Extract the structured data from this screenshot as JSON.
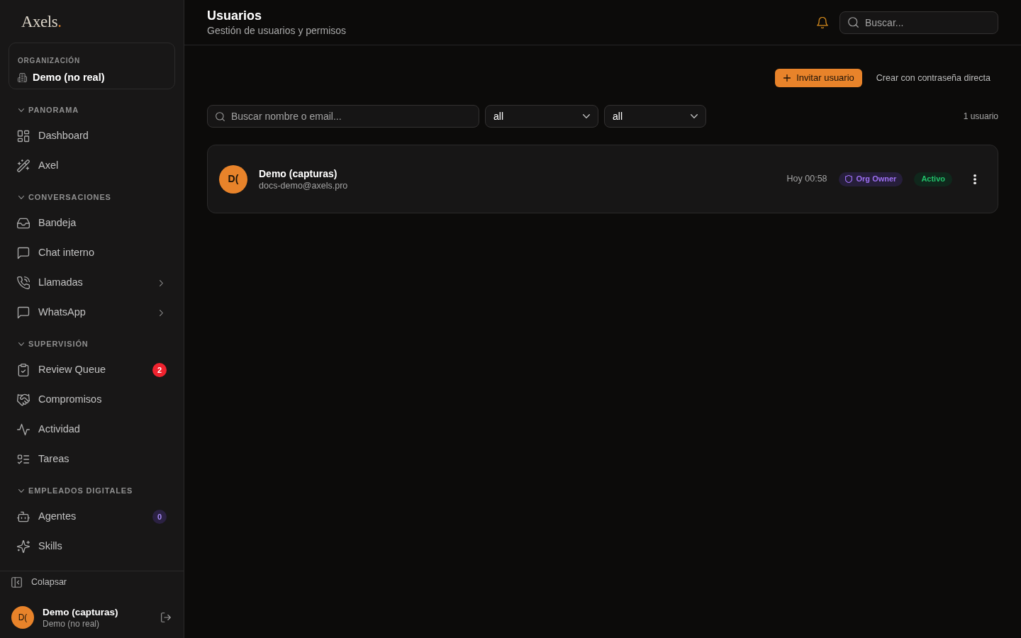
{
  "sidebar": {
    "logo": "Axels",
    "logo_mark": ".",
    "organization": {
      "label": "ORGANIZACIÓN",
      "name": "Demo (no real)"
    },
    "sections": [
      {
        "title": "PANORAMA",
        "expanded": true,
        "items": [
          {
            "label": "Dashboard",
            "selected": false,
            "has_submenu": false
          },
          {
            "label": "Axel",
            "selected": false,
            "has_submenu": false
          }
        ]
      },
      {
        "title": "CONVERSACIONES",
        "expanded": true,
        "items": [
          {
            "label": "Bandeja",
            "selected": false,
            "has_submenu": false
          },
          {
            "label": "Chat interno",
            "selected": false,
            "has_submenu": false
          },
          {
            "label": "Llamadas",
            "selected": false,
            "has_submenu": true
          },
          {
            "label": "WhatsApp",
            "selected": false,
            "has_submenu": true
          }
        ]
      },
      {
        "title": "SUPERVISIÓN",
        "expanded": true,
        "items": [
          {
            "label": "Review Queue",
            "selected": false,
            "has_submenu": false,
            "badge": {
              "text": "2",
              "kind": "alert"
            }
          },
          {
            "label": "Compromisos",
            "selected": false,
            "has_submenu": false
          },
          {
            "label": "Actividad",
            "selected": false,
            "has_submenu": false
          },
          {
            "label": "Tareas",
            "selected": false,
            "has_submenu": false
          }
        ]
      },
      {
        "title": "EMPLEADOS DIGITALES",
        "expanded": true,
        "items": [
          {
            "label": "Agentes",
            "selected": false,
            "has_submenu": false,
            "badge": {
              "text": "0",
              "kind": "count"
            }
          },
          {
            "label": "Skills",
            "selected": false,
            "has_submenu": false
          }
        ]
      }
    ],
    "collapse_label": "Colapsar",
    "user": {
      "initials": "D(",
      "name": "Demo (capturas)",
      "organization": "Demo (no real)"
    }
  },
  "header": {
    "title": "Usuarios",
    "subtitle": "Gestión de usuarios y permisos",
    "search": {
      "placeholder": "Buscar..."
    }
  },
  "actions": [
    {
      "label": "Invitar usuario",
      "kind": "primary"
    },
    {
      "label": "Crear con contraseña directa",
      "kind": "link"
    }
  ],
  "filters": {
    "search": {
      "placeholder": "Buscar nombre o email..."
    },
    "selects": [
      {
        "value": "all"
      },
      {
        "value": "all"
      }
    ],
    "count": "1 usuario"
  },
  "users": [
    {
      "initials": "D(",
      "name": "Demo (capturas)",
      "email": "docs-demo@axels.pro",
      "last_active": "Hoy 00:58",
      "role": "Org Owner",
      "status": {
        "text": "Activo",
        "kind": "active"
      }
    }
  ]
}
